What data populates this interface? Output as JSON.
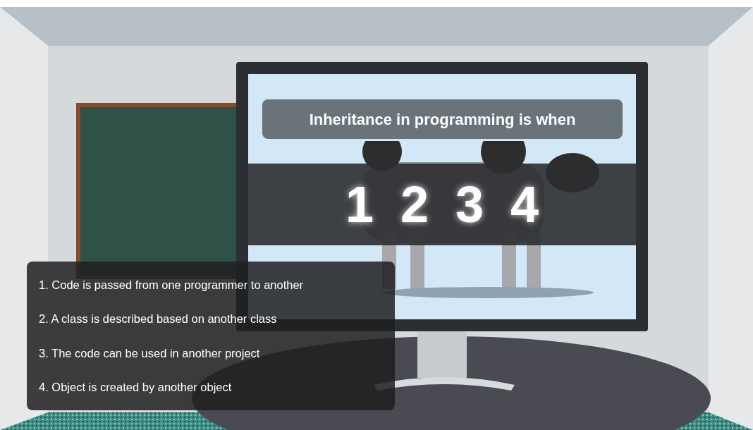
{
  "question": "Inheritance in programming is when",
  "choices": [
    "1",
    "2",
    "3",
    "4"
  ],
  "answers": [
    "1. Code is passed from one programmer to another",
    "2. A class is described based on another class",
    "3. The code can be used in another project",
    "4. Object is created by another object"
  ]
}
